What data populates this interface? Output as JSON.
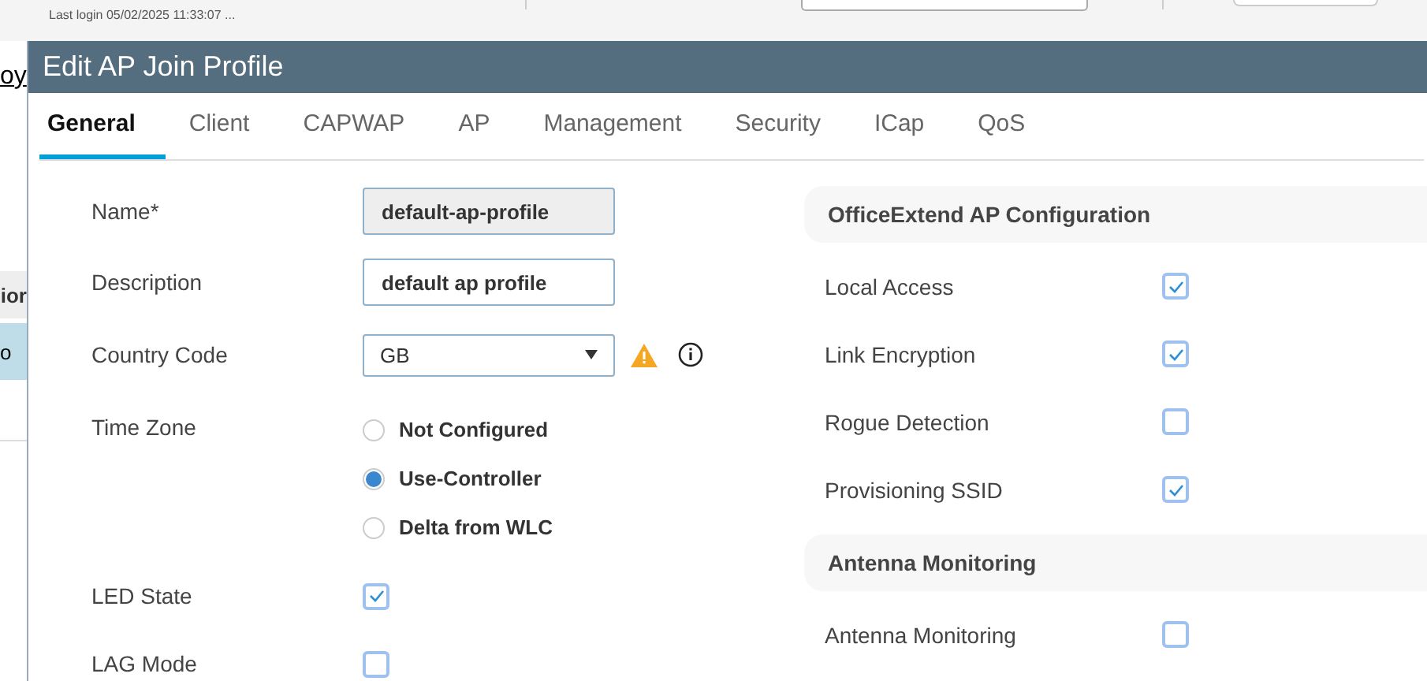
{
  "header": {
    "last_login": "Last login 05/02/2025 11:33:07 ..."
  },
  "background": {
    "link": "oy",
    "column_header": "ior",
    "row_cell": "o"
  },
  "dialog": {
    "title": "Edit AP Join Profile",
    "tabs": [
      {
        "label": "General",
        "selected": true
      },
      {
        "label": "Client",
        "selected": false
      },
      {
        "label": "CAPWAP",
        "selected": false
      },
      {
        "label": "AP",
        "selected": false
      },
      {
        "label": "Management",
        "selected": false
      },
      {
        "label": "Security",
        "selected": false
      },
      {
        "label": "ICap",
        "selected": false
      },
      {
        "label": "QoS",
        "selected": false
      }
    ],
    "fields": [
      {
        "kind": "text",
        "label": "Name*",
        "value": "default-ap-profile",
        "disabled": true
      },
      {
        "kind": "text",
        "label": "Description",
        "value": "default ap profile",
        "disabled": false
      },
      {
        "kind": "select",
        "label": "Country Code",
        "value": "GB"
      },
      {
        "kind": "radio",
        "label": "Time Zone",
        "options": [
          {
            "label": "Not Configured",
            "selected": false
          },
          {
            "label": "Use-Controller",
            "selected": true
          },
          {
            "label": "Delta from WLC",
            "selected": false
          }
        ]
      },
      {
        "kind": "checkbox",
        "label": "LED State",
        "checked": true
      },
      {
        "kind": "checkbox",
        "label": "LAG Mode",
        "checked": false
      }
    ],
    "sections": [
      {
        "title": "OfficeExtend AP Configuration",
        "items": [
          {
            "label": "Local Access",
            "checked": true
          },
          {
            "label": "Link Encryption",
            "checked": true
          },
          {
            "label": "Rogue Detection",
            "checked": false
          },
          {
            "label": "Provisioning SSID",
            "checked": true
          }
        ]
      },
      {
        "title": "Antenna Monitoring",
        "items": [
          {
            "label": "Antenna Monitoring",
            "checked": false
          }
        ]
      }
    ]
  }
}
